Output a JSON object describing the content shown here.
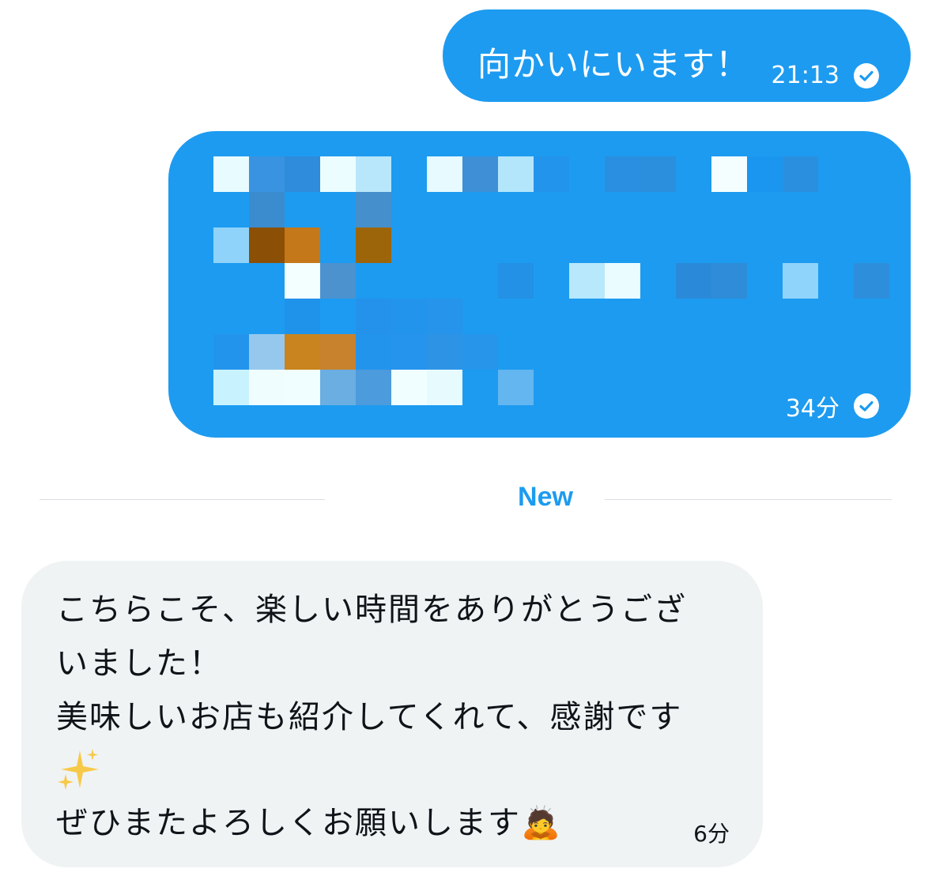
{
  "conversation": {
    "messages": [
      {
        "direction": "sent",
        "text": "向かいにいます！",
        "time": "21:13",
        "status_icon": "read-check-icon"
      },
      {
        "direction": "sent",
        "content": "pixelated-image",
        "time": "34分",
        "status_icon": "read-check-icon"
      },
      {
        "direction": "received",
        "lines": [
          "こちらこそ、楽しい時間をありがとうござ",
          "いました！",
          "美味しいお店も紹介してくれて、感謝です",
          "✨",
          "ぜひまたよろしくお願いします🙇"
        ],
        "time": "6分"
      }
    ],
    "new_divider_label": "New"
  },
  "colors": {
    "sent_bubble": "#1d9bf0",
    "received_bubble": "#eff3f4",
    "accent": "#1d9bf0",
    "divider": "#d8dde1",
    "text_dark": "#0f1419"
  }
}
